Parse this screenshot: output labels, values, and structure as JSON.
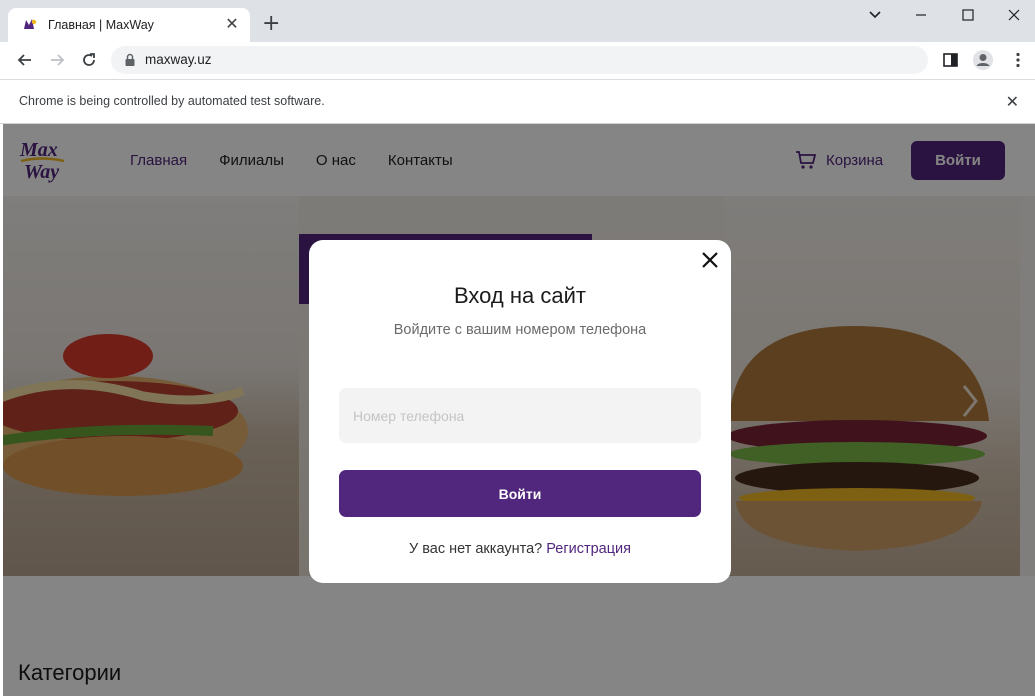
{
  "browser": {
    "tab_title": "Главная | MaxWay",
    "tab_close": "✕",
    "new_tab": "+",
    "url": "maxway.uz",
    "infobar_message": "Chrome is being controlled by automated test software.",
    "infobar_close": "✕"
  },
  "site": {
    "nav": [
      "Главная",
      "Филиалы",
      "О нас",
      "Контакты"
    ],
    "cart_label": "Корзина",
    "login_label": "Войти",
    "categories_heading": "Категории",
    "brand_color": "#51267d"
  },
  "modal": {
    "title": "Вход на сайт",
    "subtitle": "Войдите с вашим номером телефона",
    "phone_placeholder": "Номер телефона",
    "phone_value": "",
    "submit_label": "Войти",
    "no_account_text": "У вас нет аккаунта? ",
    "register_link": "Регистрация"
  }
}
